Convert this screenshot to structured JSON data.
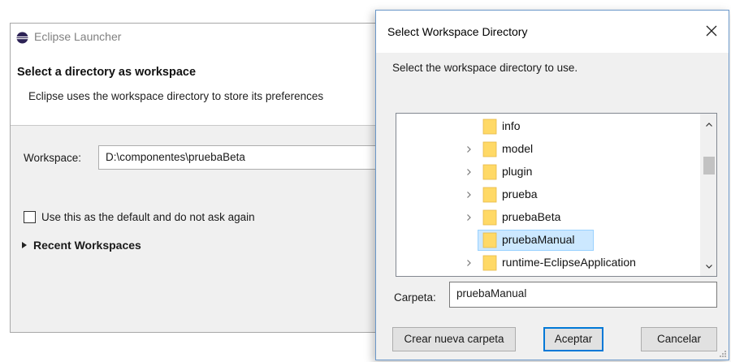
{
  "launcher": {
    "window_title": "Eclipse Launcher",
    "heading": "Select a directory as workspace",
    "description": "Eclipse uses the workspace directory to store its preferences",
    "workspace_label": "Workspace:",
    "workspace_value": "D:\\componentes\\pruebaBeta",
    "default_checkbox_label": "Use this as the default and do not ask again",
    "default_checked": false,
    "recent_workspaces_label": "Recent Workspaces"
  },
  "dialog": {
    "title": "Select Workspace Directory",
    "prompt": "Select the workspace directory to use.",
    "tree": {
      "items": [
        {
          "label": "info",
          "expandable": false,
          "selected": false
        },
        {
          "label": "model",
          "expandable": true,
          "selected": false
        },
        {
          "label": "plugin",
          "expandable": true,
          "selected": false
        },
        {
          "label": "prueba",
          "expandable": true,
          "selected": false
        },
        {
          "label": "pruebaBeta",
          "expandable": true,
          "selected": false
        },
        {
          "label": "pruebaManual",
          "expandable": false,
          "selected": true
        },
        {
          "label": "runtime-EclipseApplication",
          "expandable": true,
          "selected": false
        }
      ]
    },
    "folder_label": "Carpeta:",
    "folder_value": "pruebaManual",
    "buttons": {
      "new_folder": "Crear nueva carpeta",
      "ok": "Aceptar",
      "cancel": "Cancelar"
    }
  },
  "colors": {
    "selection_bg": "#cce8ff",
    "selection_border": "#99d1ff",
    "folder_yellow": "#ffd966",
    "dialog_border": "#6b98c9",
    "primary_button_border": "#0078d7"
  },
  "icons": {
    "app": "eclipse-icon",
    "close": "close-icon",
    "folder": "folder-icon",
    "expand": "chevron-right-icon",
    "scroll_up": "chevron-up-icon",
    "scroll_down": "chevron-down-icon"
  }
}
